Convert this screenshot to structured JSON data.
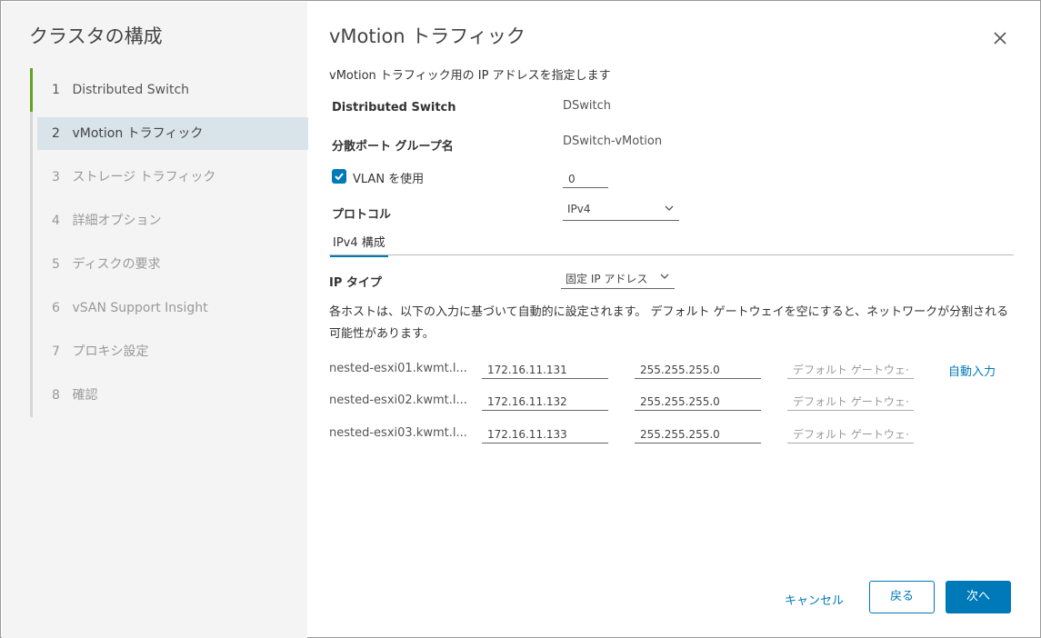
{
  "sidebar": {
    "title": "クラスタの構成",
    "steps": [
      {
        "num": "1",
        "label": "Distributed Switch"
      },
      {
        "num": "2",
        "label": "vMotion トラフィック"
      },
      {
        "num": "3",
        "label": "ストレージ トラフィック"
      },
      {
        "num": "4",
        "label": "詳細オプション"
      },
      {
        "num": "5",
        "label": "ディスクの要求"
      },
      {
        "num": "6",
        "label": "vSAN Support Insight"
      },
      {
        "num": "7",
        "label": "プロキシ設定"
      },
      {
        "num": "8",
        "label": "確認"
      }
    ]
  },
  "main": {
    "title": "vMotion トラフィック",
    "subtitle": "vMotion トラフィック用の IP アドレスを指定します",
    "distributed_switch_label": "Distributed Switch",
    "distributed_switch_value": "DSwitch",
    "port_group_label": "分散ポート グループ名",
    "port_group_value": "DSwitch-vMotion",
    "vlan_label": "VLAN を使用",
    "vlan_value": "0",
    "protocol_label": "プロトコル",
    "protocol_value": "IPv4",
    "tab_label": "IPv4 構成",
    "ip_type_label": "IP タイプ",
    "ip_type_value": "固定 IP アドレス",
    "description": "各ホストは、以下の入力に基づいて自動的に設定されます。 デフォルト ゲートウェイを空にすると、ネットワークが分割される可能性があります。",
    "gateway_placeholder": "デフォルト ゲートウェイ",
    "autofill_label": "自動入力",
    "hosts": [
      {
        "name": "nested-esxi01.kwmt.l...",
        "ip": "172.16.11.131",
        "mask": "255.255.255.0"
      },
      {
        "name": "nested-esxi02.kwmt.l...",
        "ip": "172.16.11.132",
        "mask": "255.255.255.0"
      },
      {
        "name": "nested-esxi03.kwmt.l...",
        "ip": "172.16.11.133",
        "mask": "255.255.255.0"
      }
    ]
  },
  "footer": {
    "cancel_label": "キャンセル",
    "back_label": "戻る",
    "next_label": "次へ"
  },
  "colors": {
    "accent": "#0079b8",
    "completed_step": "#62a420",
    "active_step_bg": "#d9e3ea"
  }
}
